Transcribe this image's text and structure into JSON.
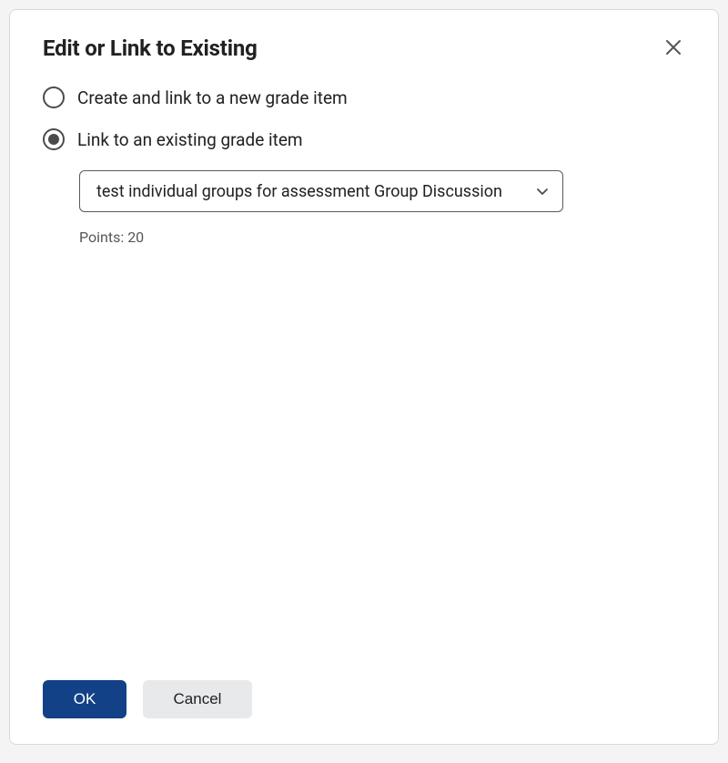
{
  "dialog": {
    "title": "Edit or Link to Existing",
    "close_icon": "close"
  },
  "options": {
    "create_label": "Create and link to a new grade item",
    "link_label": "Link to an existing grade item",
    "selected": "link"
  },
  "select": {
    "value": "test individual groups for assessment Group Discussion"
  },
  "points": {
    "label": "Points:",
    "value": "20"
  },
  "footer": {
    "ok_label": "OK",
    "cancel_label": "Cancel"
  }
}
